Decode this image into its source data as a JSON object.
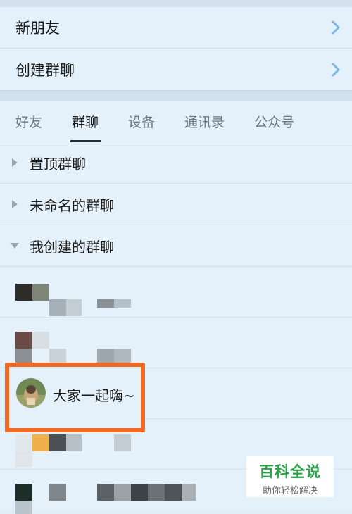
{
  "nav": {
    "new_friend": "新朋友",
    "create_group": "创建群聊"
  },
  "tabs": [
    "好友",
    "群聊",
    "设备",
    "通讯录",
    "公众号"
  ],
  "active_tab": "群聊",
  "groups": {
    "pinned": "置顶群聊",
    "unnamed": "未命名的群聊",
    "created": "我创建的群聊"
  },
  "highlighted_chat": {
    "name": "大家一起嗨~"
  },
  "colors": {
    "highlight_border": "#f06a24",
    "watermark_green": "#2aa24a"
  },
  "watermark": {
    "title": "百科全说",
    "subtitle": "助你轻松解决"
  }
}
